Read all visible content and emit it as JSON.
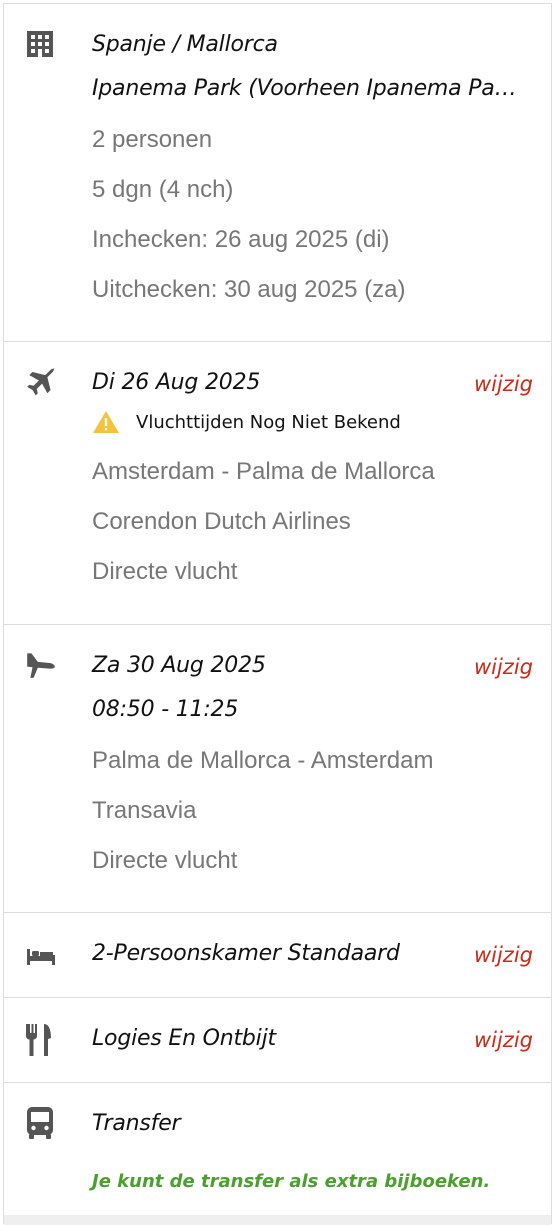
{
  "hotel": {
    "icon": "building-icon",
    "destination": "Spanje / Mallorca",
    "name": "Ipanema Park (Voorheen Ipanema Park Apartamentos)",
    "persons": "2 personen",
    "duration": "5 dgn (4 nch)",
    "checkin": "Inchecken: 26 aug 2025 (di)",
    "checkout": "Uitchecken: 30 aug 2025 (za)"
  },
  "outbound_flight": {
    "icon": "airplane-icon",
    "date": "Di 26 Aug 2025",
    "edit_label": "wijzig",
    "warning_icon": "warning-icon",
    "warning": "Vluchttijden Nog Niet Bekend",
    "route": "Amsterdam - Palma de Mallorca",
    "airline": "Corendon Dutch Airlines",
    "type": "Directe vlucht"
  },
  "return_flight": {
    "icon": "airplane-landing-icon",
    "date": "Za 30 Aug 2025",
    "edit_label": "wijzig",
    "times": "08:50 - 11:25",
    "route": "Palma de Mallorca - Amsterdam",
    "airline": "Transavia",
    "type": "Directe vlucht"
  },
  "room": {
    "icon": "bed-icon",
    "label": "2-Persoonskamer Standaard",
    "edit_label": "wijzig"
  },
  "board": {
    "icon": "fork-knife-icon",
    "label": "Logies En Ontbijt",
    "edit_label": "wijzig"
  },
  "transfer": {
    "icon": "bus-icon",
    "label": "Transfer",
    "note": "Je kunt de transfer als extra bijboeken."
  },
  "colors": {
    "edit": "#cc2a1a",
    "note": "#4aa02c",
    "warning": "#f5c33b",
    "icon": "#555555"
  }
}
